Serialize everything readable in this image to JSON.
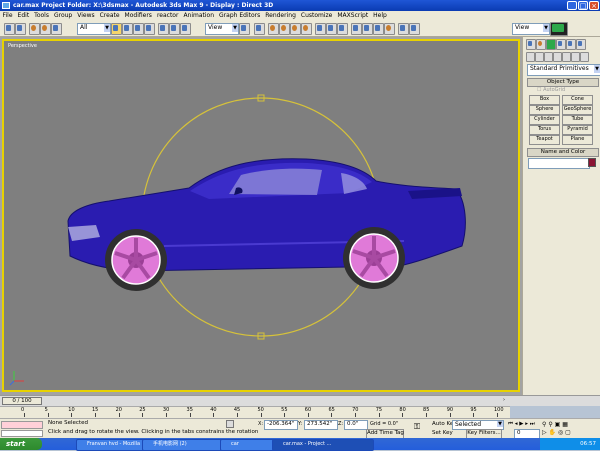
{
  "window": {
    "title": "car.max      Project Folder: X:\\3dsmax      - Autodesk 3ds Max 9      - Display : Direct 3D",
    "minimize_label": "_",
    "maximize_label": "□",
    "close_label": "×"
  },
  "menu": [
    "File",
    "Edit",
    "Tools",
    "Group",
    "Views",
    "Create",
    "Modifiers",
    "reactor",
    "Animation",
    "Graph Editors",
    "Rendering",
    "Customize",
    "MAXScript",
    "Help"
  ],
  "toolbar": {
    "selection_filter": "All",
    "reference_coord": "View",
    "named_selection": "View"
  },
  "viewport": {
    "label": "Perspective",
    "border_color": "#e8d200",
    "car_body_color": "#2a1cb0",
    "wheel_color": "#e07ad8",
    "gizmo_color": "#d6c23a"
  },
  "command_panel": {
    "category": "Standard Primitives",
    "object_type_header": "Object Type",
    "autogrid_label": "AutoGrid",
    "primitives": [
      "Box",
      "Cone",
      "Sphere",
      "GeoSphere",
      "Cylinder",
      "Tube",
      "Torus",
      "Pyramid",
      "Teapot",
      "Plane"
    ],
    "name_color_header": "Name and Color",
    "object_color": "#8b1434"
  },
  "timeline": {
    "slider_label": "0 / 100",
    "ticks": [
      "0",
      "5",
      "10",
      "15",
      "20",
      "25",
      "30",
      "35",
      "40",
      "45",
      "50",
      "55",
      "60",
      "65",
      "70",
      "75",
      "80",
      "85",
      "90",
      "95",
      "100"
    ]
  },
  "status": {
    "selection": "None Selected",
    "prompt": "Click and drag to rotate the view.  Clicking in the tabs constrains the rotation",
    "x_label": "X:",
    "x_value": "-206.364\"",
    "y_label": "Y:",
    "y_value": "273.542\"",
    "z_label": "Z:",
    "z_value": "0.0\"",
    "grid": "Grid = 0.0\"",
    "add_time_tag": "Add Time Tag",
    "auto_key": "Auto Key",
    "set_key": "Set Key",
    "key_mode_select": "Selected",
    "key_filters": "Key Filters...",
    "frame": "0"
  },
  "taskbar": {
    "start": "start",
    "tasks": [
      "Franvan hvd - Mozilla",
      "手机电影网 (2)",
      "car",
      "car.max - Project ..."
    ],
    "clock": "06:57"
  }
}
